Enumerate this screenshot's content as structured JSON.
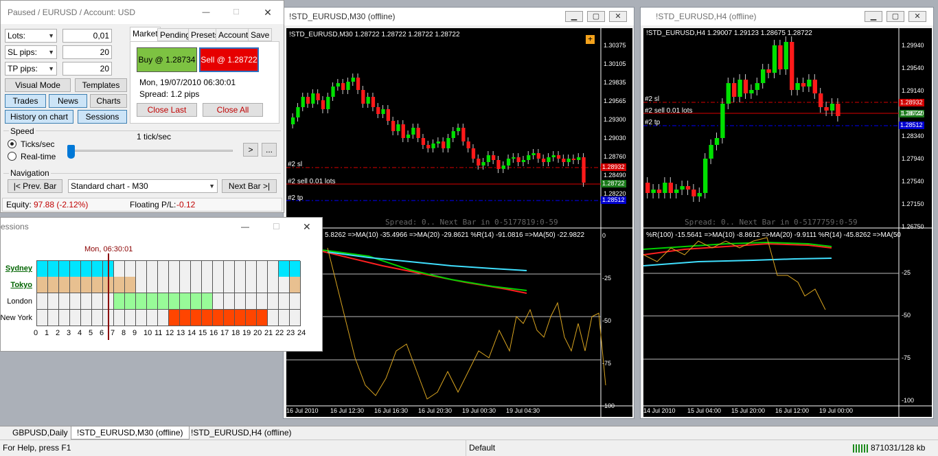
{
  "panel": {
    "title": "Paused / EURUSD / Account: USD",
    "lots_label": "Lots:",
    "lots_value": "0,01",
    "sl_label": "SL pips:",
    "sl_value": "20",
    "tp_label": "TP pips:",
    "tp_value": "20",
    "visual_mode": "Visual Mode",
    "templates": "Templates",
    "trades": "Trades",
    "news": "News",
    "charts": "Charts",
    "history_on_chart": "History on chart",
    "sessions": "Sessions",
    "tabs": [
      "Market",
      "Pending",
      "Presets",
      "Account",
      "Save"
    ],
    "buy_label": "Buy @ 1.28734",
    "sell_label": "Sell @ 1.28722",
    "datetime": "Mon, 19/07/2010  06:30:01",
    "spread": "Spread: 1.2 pips",
    "close_last": "Close Last",
    "close_all": "Close All",
    "speed_label": "Speed",
    "speed_value": "1 tick/sec",
    "ticks_sec": "Ticks/sec",
    "real_time": "Real-time",
    "play_symbol": ">",
    "more_symbol": "...",
    "navigation_label": "Navigation",
    "prev_bar": "|< Prev. Bar",
    "chart_select": "Standard chart - M30",
    "next_bar": "Next Bar >|",
    "equity_label": "Equity:",
    "equity_value": "97.88  (-2.12%)",
    "floating_label": "Floating P/L:",
    "floating_value": "-0.12"
  },
  "sessions_window": {
    "title": "essions",
    "time_marker": "Mon, 06:30:01",
    "rows": [
      {
        "name": "Sydney",
        "link": true
      },
      {
        "name": "Tokyo",
        "link": true
      },
      {
        "name": "London",
        "link": false
      },
      {
        "name": "New York",
        "link": false
      }
    ],
    "hours": [
      "0",
      "1",
      "2",
      "3",
      "4",
      "5",
      "6",
      "7",
      "8",
      "9",
      "10",
      "11",
      "12",
      "13",
      "14",
      "15",
      "16",
      "17",
      "18",
      "19",
      "20",
      "21",
      "22",
      "23",
      "24"
    ],
    "colors": {
      "sydney": "#00e5ff",
      "tokyo": "#e8c090",
      "london": "#98fb98",
      "newyork": "#ff4500",
      "empty": "#f0f0f0",
      "marker": "#8b0000"
    }
  },
  "chart_m30": {
    "title": "!STD_EURUSD,M30 (offline)",
    "header": "!STD_EURUSD,M30  1.28722 1.28722 1.28722 1.28722",
    "price_ticks": [
      "1.30375",
      "1.30105",
      "1.29835",
      "1.29565",
      "1.29300",
      "1.29030",
      "1.28760",
      "1.28490",
      "1.28220"
    ],
    "sl_label": "#2 sl",
    "sell_label": "#2 sell 0.01 lots",
    "tp_label": "#2 tp",
    "sl_price": "1.28932",
    "sell_price": "1.28722",
    "tp_price": "1.28512",
    "spread_text": "Spread: 0.. Next Bar in 0-5177819:0-59",
    "indicator_header": "5.8262  =>MA(10) -35.4966  =>MA(20) -29.8621  %R(14) -91.0816  =>MA(50) -22.9822",
    "ind_ticks": [
      "0",
      "-25",
      "-50",
      "-75",
      "-100"
    ],
    "time_labels": [
      "16 Jul 2010",
      "16 Jul 12:30",
      "16 Jul 16:30",
      "16 Jul 20:30",
      "19 Jul 00:30",
      "19 Jul 04:30"
    ]
  },
  "chart_h4": {
    "title": "!STD_EURUSD,H4 (offline)",
    "header": "!STD_EURUSD,H4  1.29007 1.29123 1.28675 1.28722",
    "price_ticks": [
      "1.29940",
      "1.29540",
      "1.29140",
      "1.28740",
      "1.28340",
      "1.27940",
      "1.27540",
      "1.27150",
      "1.26750"
    ],
    "sl_label": "#2 sl",
    "sell_label": "#2 sell 0.01 lots",
    "tp_label": "#2 tp",
    "sl_price": "1.28932",
    "sell_price": "1.28722",
    "tp_price": "1.28512",
    "spread_text": "Spread: 0.. Next Bar in 0-5177759:0-59",
    "indicator_header": "%R(100) -15.5641  =>MA(10) -8.8612  =>MA(20) -9.9111  %R(14) -45.8262  =>MA(50",
    "ind_ticks": [
      "-25",
      "-50",
      "-75",
      "-100"
    ],
    "time_labels": [
      "14 Jul 2010",
      "15 Jul 04:00",
      "15 Jul 20:00",
      "16 Jul 12:00",
      "19 Jul 00:00"
    ]
  },
  "chart_tabs": [
    "GBPUSD,Daily",
    "!STD_EURUSD,M30 (offline)",
    "!STD_EURUSD,H4 (offline)"
  ],
  "status": {
    "help": "For Help, press F1",
    "profile": "Default",
    "traffic": "871031/128 kb"
  }
}
